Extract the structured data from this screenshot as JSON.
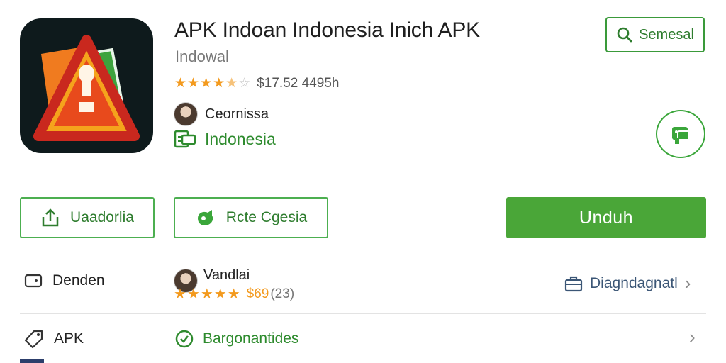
{
  "app": {
    "title": "APK Indoan Indonesia  Inich APK",
    "developer": "Indowal",
    "rating_text": "$17.52 4495h",
    "stars": 4.5,
    "publisher": "Ceornissa",
    "country": "Indonesia"
  },
  "header": {
    "search_label": "Semesal"
  },
  "actions": {
    "upload_label": "Uaadorlia",
    "rate_label": "Rcte Cgesia",
    "download_label": "Unduh"
  },
  "rows": [
    {
      "left_label": "Denden",
      "reviewer": "Vandlai",
      "review_stars": 5,
      "review_price": "$69",
      "review_count": "(23)",
      "right_label": "Diagndagnatl"
    },
    {
      "left_label": "APK",
      "middle_label": "Bargonantides"
    }
  ],
  "colors": {
    "accent_green": "#4aa638",
    "text_green": "#2e8b2e",
    "star_orange": "#f39a1e",
    "icon_bg": "#0e1a1c"
  },
  "icons": [
    "app-logo-icon",
    "search-icon",
    "share-icon",
    "upload-icon",
    "rate-icon",
    "wallet-icon",
    "briefcase-icon",
    "tag-icon",
    "clock-icon",
    "chevron-right-icon",
    "flag-icon"
  ]
}
